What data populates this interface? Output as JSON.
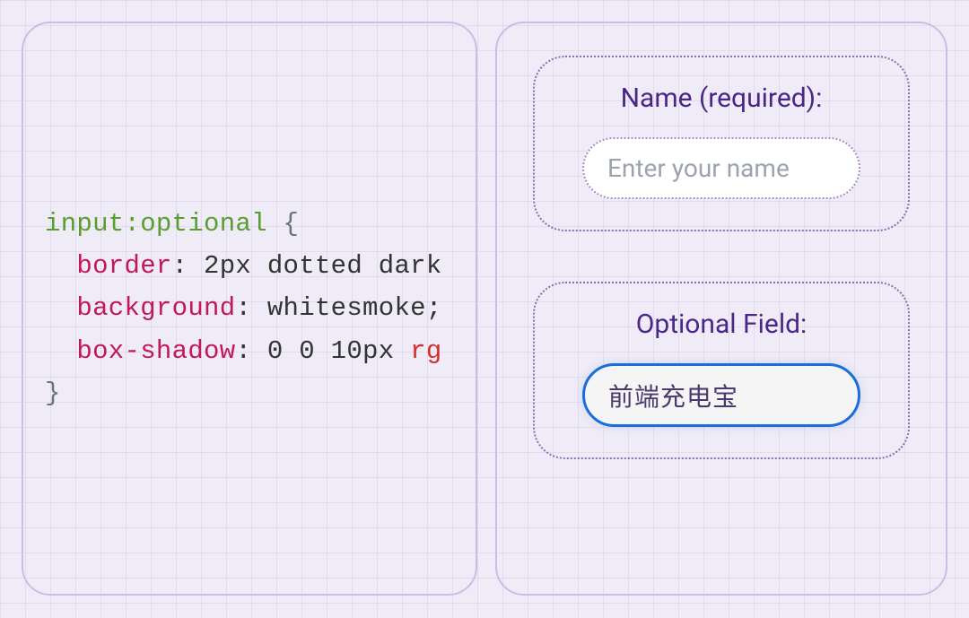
{
  "code": {
    "selector": "input",
    "pseudo": ":optional",
    "open_brace": " {",
    "prop1": "border",
    "val1_part": " 2px dotted dark",
    "prop2": "background",
    "val2": " whitesmoke;",
    "prop3": "box-shadow",
    "val3_part": " 0 0 10px ",
    "val3_func": "rg",
    "close_brace": "}",
    "indent": "  ",
    "colon": ":"
  },
  "preview": {
    "group1": {
      "label": "Name (required):",
      "placeholder": "Enter your name"
    },
    "group2": {
      "label": "Optional Field:",
      "value": "前端充电宝"
    }
  }
}
